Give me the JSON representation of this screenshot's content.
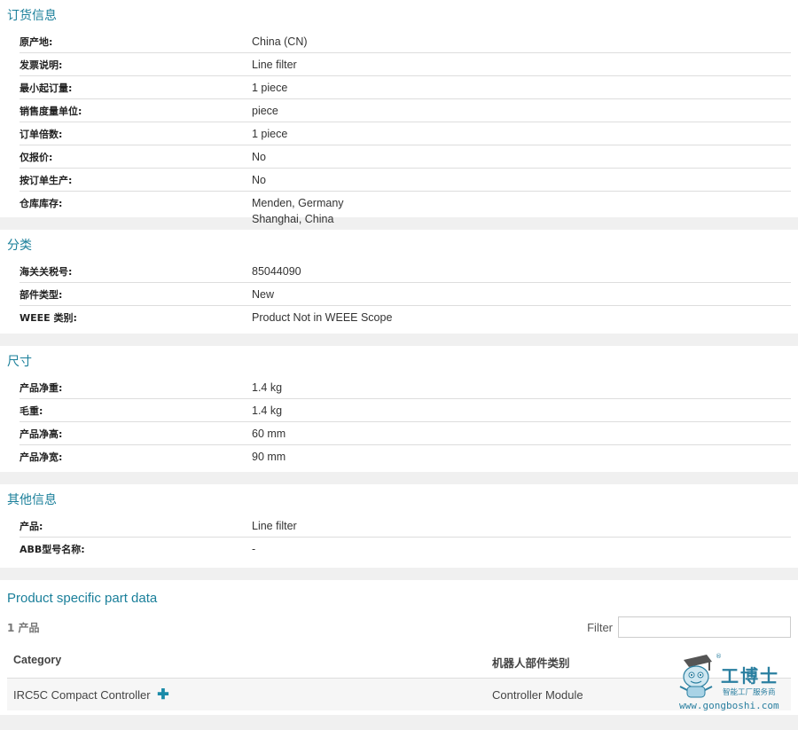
{
  "order_info": {
    "title": "订货信息",
    "rows": [
      {
        "k": "原产地:",
        "v": [
          "China (CN)"
        ]
      },
      {
        "k": "发票说明:",
        "v": [
          "Line filter"
        ]
      },
      {
        "k": "最小起订量:",
        "v": [
          "1 piece"
        ]
      },
      {
        "k": "销售度量单位:",
        "v": [
          "piece"
        ]
      },
      {
        "k": "订单倍数:",
        "v": [
          "1 piece"
        ]
      },
      {
        "k": "仅报价:",
        "v": [
          "No"
        ]
      },
      {
        "k": "按订单生产:",
        "v": [
          "No"
        ]
      },
      {
        "k": "仓库库存:",
        "v": [
          "Menden, Germany",
          "Shanghai, China"
        ]
      }
    ]
  },
  "classification": {
    "title": "分类",
    "rows": [
      {
        "k": "海关关税号:",
        "v": [
          "85044090"
        ]
      },
      {
        "k": "部件类型:",
        "v": [
          "New"
        ]
      },
      {
        "k": "WEEE 类别:",
        "v": [
          "Product Not in WEEE Scope"
        ]
      }
    ]
  },
  "dimensions": {
    "title": "尺寸",
    "rows": [
      {
        "k": "产品净重:",
        "v": [
          "1.4 kg"
        ]
      },
      {
        "k": "毛重:",
        "v": [
          "1.4 kg"
        ]
      },
      {
        "k": "产品净高:",
        "v": [
          "60 mm"
        ]
      },
      {
        "k": "产品净宽:",
        "v": [
          "90 mm"
        ]
      }
    ]
  },
  "other_info": {
    "title": "其他信息",
    "rows": [
      {
        "k": "产品:",
        "v": [
          "Line filter"
        ]
      },
      {
        "k": "ABB型号名称:",
        "v": [
          "-"
        ]
      }
    ]
  },
  "product_specific": {
    "title": "Product specific part data",
    "count": "1 产品",
    "filter_label": "Filter",
    "filter_value": "",
    "headers": [
      "Category",
      "机器人部件类别"
    ],
    "rows": [
      {
        "category": "IRC5C Compact Controller",
        "robot_part": "Controller Module",
        "expand_symbol": "✚"
      }
    ]
  },
  "watermark": {
    "brand": "工博士",
    "subtitle": "智能工厂服务商",
    "url": "www.gongboshi.com",
    "reg": "®"
  }
}
